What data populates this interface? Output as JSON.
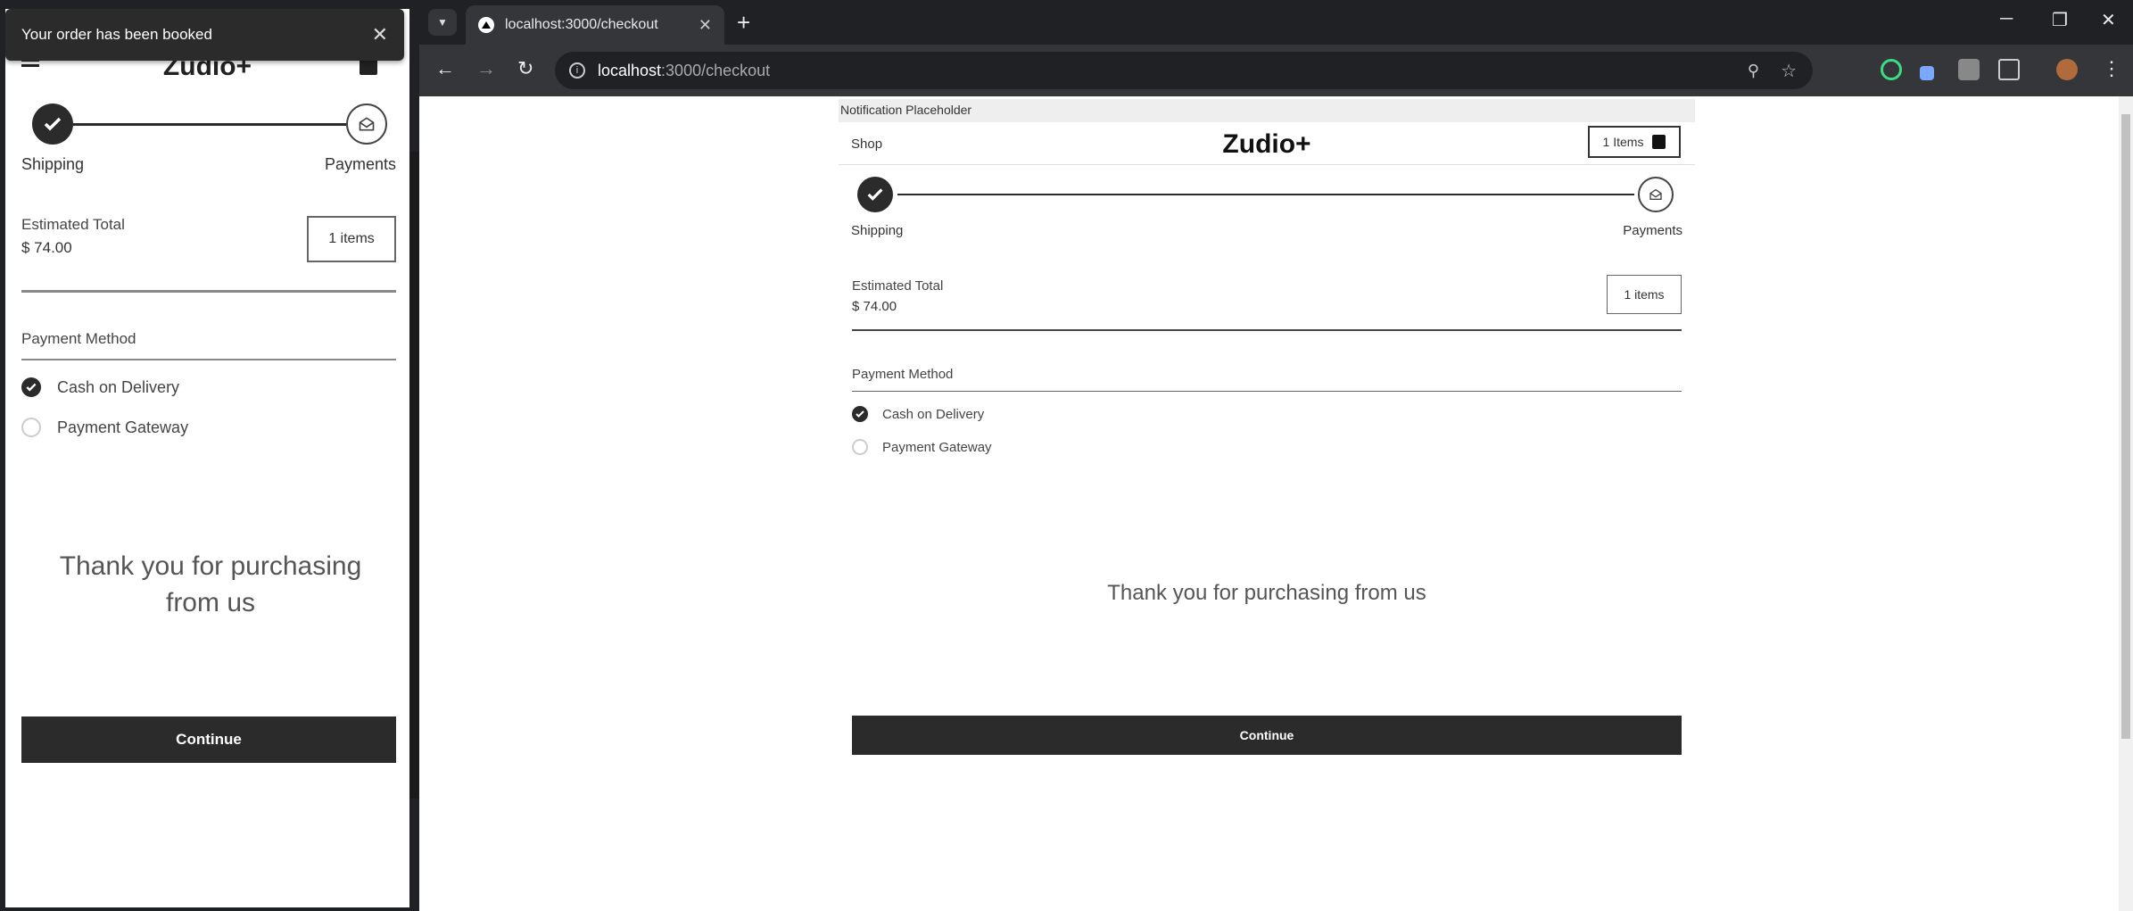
{
  "toast": {
    "message": "Your order has been booked",
    "close": "✕"
  },
  "brand": {
    "logo": "Zudio+",
    "mobile_logo_partial": "Zudio+"
  },
  "browser": {
    "tab_title": "localhost:3000/checkout",
    "url_host": "localhost",
    "url_path": ":3000/checkout",
    "new_tab": "+",
    "minimize": "─",
    "restore": "❐",
    "close": "✕"
  },
  "page": {
    "notification": "Notification Placeholder",
    "shop_link": "Shop",
    "cart_label": "1 Items",
    "stepper": {
      "step1": "Shipping",
      "step2": "Payments"
    },
    "estimated_total_label": "Estimated Total",
    "estimated_total_value": "$ 74.00",
    "items_button": "1 items",
    "payment_method_label": "Payment Method",
    "payment_options": [
      {
        "label": "Cash on Delivery",
        "selected": true
      },
      {
        "label": "Payment Gateway",
        "selected": false
      }
    ],
    "thank_you": "Thank you for purchasing from us",
    "continue_button": "Continue"
  },
  "colors": {
    "primary_dark": "#2b2b2b",
    "chrome_bg": "#202124",
    "toolbar_bg": "#35363a"
  }
}
